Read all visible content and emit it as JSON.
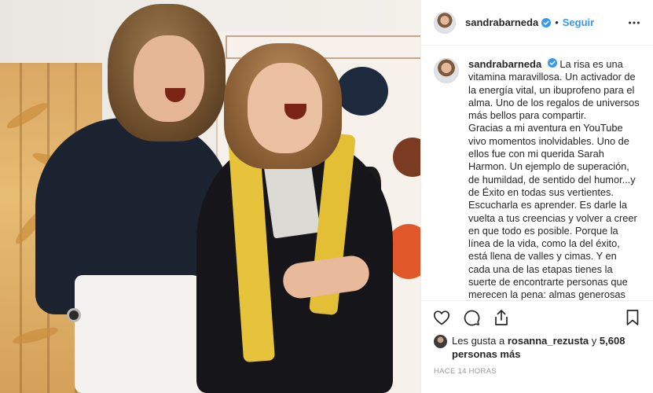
{
  "post": {
    "author": "sandrabarneda",
    "separator": "•",
    "follow_label": "Seguir",
    "caption_lines": [
      "La risa es una vitamina maravillosa. Un activador de la energía vital, un ibuprofeno para el alma. Uno de los regalos de universos más bellos para compartir.",
      "Gracias a mi aventura en YouTube vivo momentos inolvidables. Uno de ellos fue con mi querida Sarah Harmon. Un ejemplo de superación, de humildad, de sentido del humor...y de Éxito en todas sus vertientes.",
      "Escucharla es aprender. Es darle la vuelta a tus creencias y volver a creer en que todo es posible. Porque la línea de la vida, como la del éxito, está llena de valles y cimas. Y en cada una de las etapas tienes la suerte de encontrarte personas que merecen la pena: almas generosas que te ofrecen"
    ],
    "likes_prefix": "Les gusta a",
    "likes_user": "rosanna_rezusta",
    "likes_and": "y",
    "likes_count": "5,608 personas más",
    "timestamp": "HACE 14 HORAS"
  },
  "icons": {
    "verified": "verified-badge-icon",
    "more": "more-options-icon",
    "like": "heart-icon",
    "comment": "comment-icon",
    "share": "share-icon",
    "save": "bookmark-icon"
  },
  "colors": {
    "accent": "#3897f0",
    "text": "#262626",
    "muted": "#999999",
    "border": "#efefef"
  }
}
